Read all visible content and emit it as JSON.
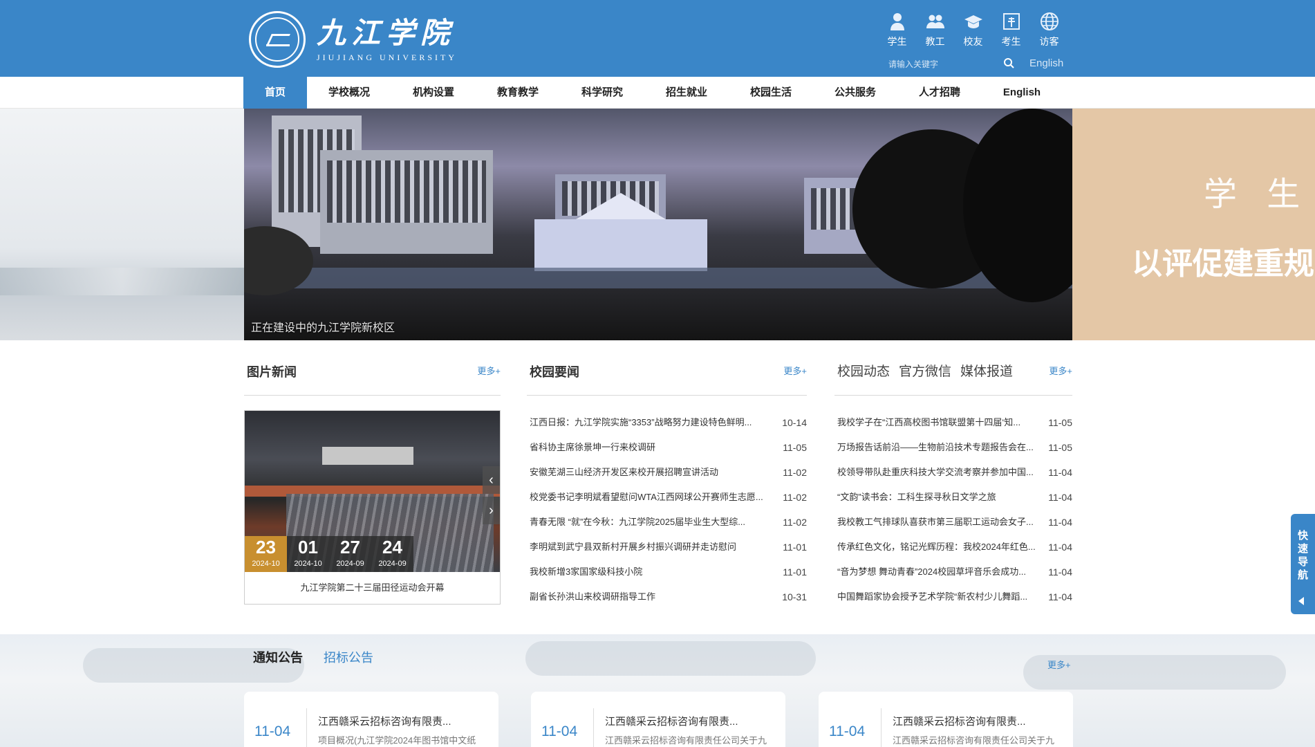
{
  "header": {
    "logo_cn": "九江学院",
    "logo_en": "JIUJIANG   UNIVERSITY",
    "quick_links": [
      {
        "label": "学生",
        "icon": "student-icon"
      },
      {
        "label": "教工",
        "icon": "staff-icon"
      },
      {
        "label": "校友",
        "icon": "alumni-icon"
      },
      {
        "label": "考生",
        "icon": "applicant-icon"
      },
      {
        "label": "访客",
        "icon": "visitor-icon"
      }
    ],
    "search_placeholder": "请输入关键字",
    "english_link": "English"
  },
  "nav": {
    "items": [
      {
        "label": "首页",
        "active": true
      },
      {
        "label": "学校概况"
      },
      {
        "label": "机构设置"
      },
      {
        "label": "教育教学"
      },
      {
        "label": "科学研究"
      },
      {
        "label": "招生就业"
      },
      {
        "label": "校园生活"
      },
      {
        "label": "公共服务"
      },
      {
        "label": "人才招聘"
      },
      {
        "label": "English"
      }
    ]
  },
  "banner": {
    "caption": "正在建设中的九江学院新校区",
    "right_line1": "学 生 中",
    "right_line2": "以评促建重规"
  },
  "photo_news": {
    "title": "图片新闻",
    "more": "更多+",
    "caption": "九江学院第二十三届田径运动会开幕",
    "dates": [
      {
        "day": "23",
        "ym": "2024-10",
        "active": true
      },
      {
        "day": "01",
        "ym": "2024-10"
      },
      {
        "day": "27",
        "ym": "2024-09"
      },
      {
        "day": "24",
        "ym": "2024-09"
      }
    ]
  },
  "campus_news": {
    "title": "校园要闻",
    "more": "更多+",
    "items": [
      {
        "title": "江西日报：九江学院实施“3353”战略努力建设特色鲜明...",
        "date": "10-14"
      },
      {
        "title": "省科协主席徐景坤一行来校调研",
        "date": "11-05"
      },
      {
        "title": "安徽芜湖三山经济开发区来校开展招聘宣讲活动",
        "date": "11-02"
      },
      {
        "title": "校党委书记李明斌看望慰问WTA江西网球公开赛师生志愿...",
        "date": "11-02"
      },
      {
        "title": "青春无限 “就”在今秋：九江学院2025届毕业生大型综...",
        "date": "11-02"
      },
      {
        "title": "李明斌到武宁县双新村开展乡村振兴调研并走访慰问",
        "date": "11-01"
      },
      {
        "title": "我校新增3家国家级科技小院",
        "date": "11-01"
      },
      {
        "title": "副省长孙洪山来校调研指导工作",
        "date": "10-31"
      }
    ]
  },
  "dynamics": {
    "tabs": [
      "校园动态",
      "官方微信",
      "媒体报道"
    ],
    "more": "更多+",
    "items": [
      {
        "title": "我校学子在“江西高校图书馆联盟第十四届‘知...",
        "date": "11-05"
      },
      {
        "title": "万场报告话前沿——生物前沿技术专题报告会在...",
        "date": "11-05"
      },
      {
        "title": "校领导带队赴重庆科技大学交流考察并参加中国...",
        "date": "11-04"
      },
      {
        "title": "“文韵”读书会：工科生探寻秋日文学之旅",
        "date": "11-04"
      },
      {
        "title": "我校教工气排球队喜获市第三届职工运动会女子...",
        "date": "11-04"
      },
      {
        "title": "传承红色文化，铭记光辉历程：我校2024年红色...",
        "date": "11-04"
      },
      {
        "title": "“音为梦想 舞动青春”2024校园草坪音乐会成功...",
        "date": "11-04"
      },
      {
        "title": "中国舞蹈家协会授予艺术学院“新农村少儿舞蹈...",
        "date": "11-04"
      }
    ]
  },
  "float_nav": {
    "label": "快速导航"
  },
  "notices": {
    "tabs": [
      {
        "label": "通知公告",
        "active": true
      },
      {
        "label": "招标公告"
      }
    ],
    "more": "更多+",
    "cards": [
      {
        "date": "11-04",
        "title": "江西赣采云招标咨询有限责...",
        "desc": "项目概况(九江学院2024年图书馆中文纸"
      },
      {
        "date": "11-04",
        "title": "江西赣采云招标咨询有限责...",
        "desc": "江西赣采云招标咨询有限责任公司关于九"
      },
      {
        "date": "11-04",
        "title": "江西赣采云招标咨询有限责...",
        "desc": "江西赣采云招标咨询有限责任公司关于九"
      }
    ]
  },
  "colors": {
    "brand_blue": "#3a86c8",
    "active_date": "#c88f2f",
    "banner_right_bg": "#e4c7a6"
  }
}
